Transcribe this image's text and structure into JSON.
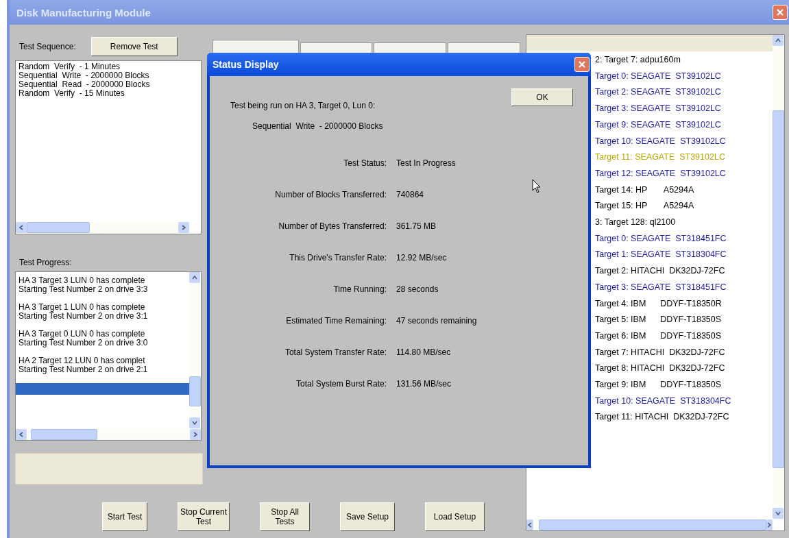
{
  "window": {
    "title": "Disk Manufacturing Module"
  },
  "test_sequence": {
    "label": "Test Sequence:",
    "remove_button": "Remove Test",
    "items": [
      "Random  Verify  - 1 Minutes",
      "Sequential  Write  - 2000000 Blocks",
      "Sequential  Read  - 2000000 Blocks",
      "Random  Verify  - 15 Minutes"
    ]
  },
  "test_progress": {
    "label": "Test Progress:",
    "entries": [
      {
        "lines": [
          "HA 3 Target 3 LUN 0 has complete",
          "Starting Test Number 2 on drive 3:3"
        ],
        "selected": false
      },
      {
        "lines": [
          "HA 3 Target 1 LUN 0 has complete",
          "Starting Test Number 2 on drive 3:1"
        ],
        "selected": false
      },
      {
        "lines": [
          "HA 3 Target 0 LUN 0 has complete",
          "Starting Test Number 2 on drive 3:0"
        ],
        "selected": false
      },
      {
        "lines": [
          "HA 2 Target 12 LUN 0 has complet",
          "Starting Test Number 2 on drive 2:1"
        ],
        "selected": false
      },
      {
        "selected": true
      }
    ]
  },
  "tabs": [
    {
      "selected": true
    },
    {
      "selected": false
    },
    {
      "selected": false
    },
    {
      "selected": false
    }
  ],
  "buttons": [
    "Start Test",
    "Stop Current\nTest",
    "Stop All\nTests",
    "Save Setup",
    "Load Setup"
  ],
  "device_list": {
    "items": [
      {
        "text": "2: Target 7: adpu160m",
        "color": "#000000"
      },
      {
        "text": "Target 0: SEAGATE  ST39102LC",
        "color": "#1a1aa8"
      },
      {
        "text": "Target 2: SEAGATE  ST39102LC",
        "color": "#1a1aa8"
      },
      {
        "text": "Target 3: SEAGATE  ST39102LC",
        "color": "#1a1aa8"
      },
      {
        "text": "Target 9: SEAGATE  ST39102LC",
        "color": "#1a1aa8"
      },
      {
        "text": "Target 10: SEAGATE  ST39102LC",
        "color": "#1a1aa8"
      },
      {
        "text": "Target 11: SEAGATE  ST39102LC",
        "color": "#b8a800"
      },
      {
        "text": "Target 12: SEAGATE  ST39102LC",
        "color": "#1a1aa8"
      },
      {
        "text": "Target 14: HP       A5294A",
        "color": "#000000"
      },
      {
        "text": "Target 15: HP       A5294A",
        "color": "#000000"
      },
      {
        "text": "3: Target 128: ql2100",
        "color": "#000000"
      },
      {
        "text": "Target 0: SEAGATE  ST318451FC",
        "color": "#1a1aa8"
      },
      {
        "text": "Target 1: SEAGATE  ST318304FC",
        "color": "#1a1aa8"
      },
      {
        "text": "Target 2: HITACHI  DK32DJ-72FC",
        "color": "#000000"
      },
      {
        "text": "Target 3: SEAGATE  ST318451FC",
        "color": "#1a1aa8"
      },
      {
        "text": "Target 4: IBM      DDYF-T18350R",
        "color": "#000000"
      },
      {
        "text": "Target 5: IBM      DDYF-T18350S",
        "color": "#000000"
      },
      {
        "text": "Target 6: IBM      DDYF-T18350S",
        "color": "#000000"
      },
      {
        "text": "Target 7: HITACHI  DK32DJ-72FC",
        "color": "#000000"
      },
      {
        "text": "Target 8: HITACHI  DK32DJ-72FC",
        "color": "#000000"
      },
      {
        "text": "Target 9: IBM      DDYF-T18350S",
        "color": "#000000"
      },
      {
        "text": "Target 10: SEAGATE  ST318304FC",
        "color": "#1a1aa8"
      },
      {
        "text": "Target 11: HITACHI  DK32DJ-72FC",
        "color": "#000000"
      }
    ]
  },
  "status_dialog": {
    "title": "Status Display",
    "ok_button": "OK",
    "heading": "Test being run on HA 3, Target 0, Lun 0:",
    "test": "Sequential  Write  - 2000000 Blocks",
    "rows": [
      {
        "label": "Test Status:",
        "value": "Test In Progress"
      },
      {
        "label": "Number of Blocks Transferred:",
        "value": "740864"
      },
      {
        "label": "Number of Bytes Transferred:",
        "value": "361.75 MB"
      },
      {
        "label": "This Drive's Transfer Rate:",
        "value": "12.92 MB/sec"
      },
      {
        "label": "Time Running:",
        "value": "28 seconds"
      },
      {
        "label": "Estimated Time Remaining:",
        "value": "47 seconds remaining"
      },
      {
        "label": "Total System Transfer Rate:",
        "value": "114.80 MB/sec"
      },
      {
        "label": "Total System Burst Rate:",
        "value": "131.56 MB/sec"
      }
    ]
  }
}
